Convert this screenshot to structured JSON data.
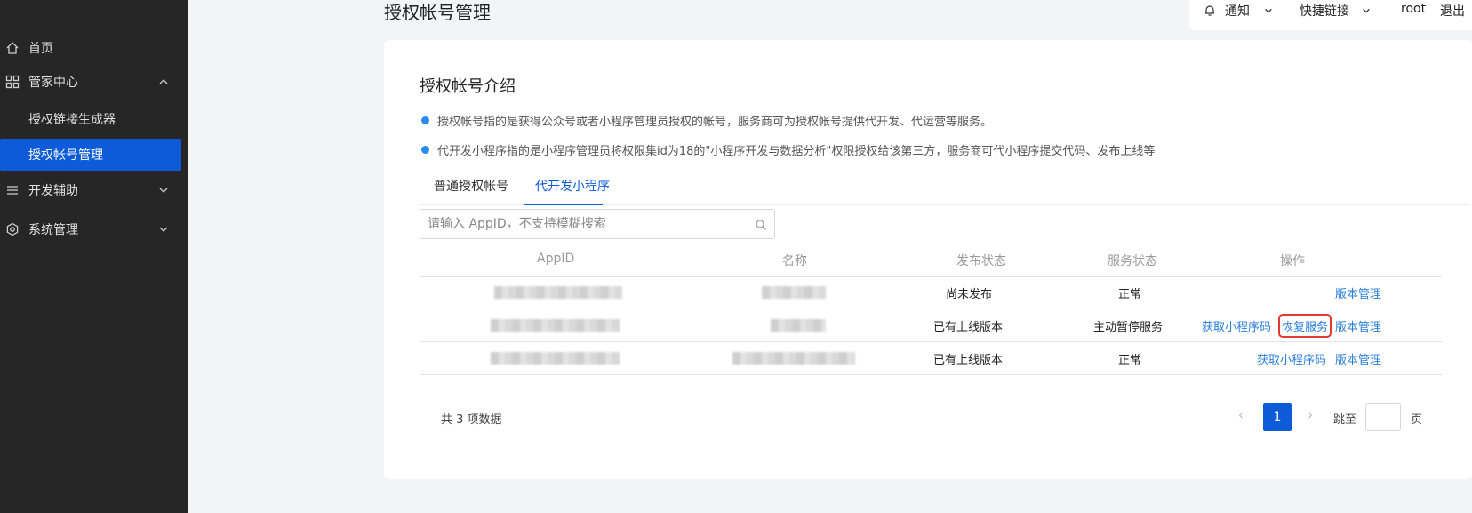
{
  "colors": {
    "sidebar_bg": "#262626",
    "accent": "#0d5bd8",
    "link": "#2b7fdc",
    "highlight": "#e53935"
  },
  "page_title": "授权帐号管理",
  "sidebar": {
    "items": [
      {
        "label": "首页",
        "icon": "home-icon"
      },
      {
        "label": "管家中心",
        "icon": "grid-icon",
        "expanded": true
      },
      {
        "label": "授权链接生成器"
      },
      {
        "label": "授权帐号管理",
        "active": true
      },
      {
        "label": "开发辅助",
        "icon": "menu-icon"
      },
      {
        "label": "系统管理",
        "icon": "hexagon-gear-icon"
      }
    ]
  },
  "topbar": {
    "notify": "通知",
    "quick_links": "快捷链接",
    "user": "root",
    "logout": "退出"
  },
  "intro": {
    "title": "授权帐号介绍",
    "bullets": [
      "授权帐号指的是获得公众号或者小程序管理员授权的帐号，服务商可为授权帐号提供代开发、代运营等服务。",
      "代开发小程序指的是小程序管理员将权限集id为18的\"小程序开发与数据分析\"权限授权给该第三方，服务商可代小程序提交代码、发布上线等"
    ]
  },
  "tabs": [
    {
      "label": "普通授权帐号"
    },
    {
      "label": "代开发小程序",
      "active": true
    }
  ],
  "search": {
    "placeholder": "请输入 AppID，不支持模糊搜索",
    "value": ""
  },
  "table": {
    "headers": [
      "AppID",
      "名称",
      "发布状态",
      "服务状态",
      "操作"
    ],
    "rows": [
      {
        "publish_status": "尚未发布",
        "service_status": "正常",
        "actions": [
          "版本管理"
        ]
      },
      {
        "publish_status": "已有上线版本",
        "service_status": "主动暂停服务",
        "actions": [
          "获取小程序码",
          "恢复服务",
          "版本管理"
        ]
      },
      {
        "publish_status": "已有上线版本",
        "service_status": "正常",
        "actions": [
          "获取小程序码",
          "版本管理"
        ]
      }
    ]
  },
  "footer": {
    "total": "共 3 项数据",
    "current_page": "1",
    "jump_label": "跳至",
    "page_label": "页",
    "prev": "‹",
    "next": "›"
  }
}
